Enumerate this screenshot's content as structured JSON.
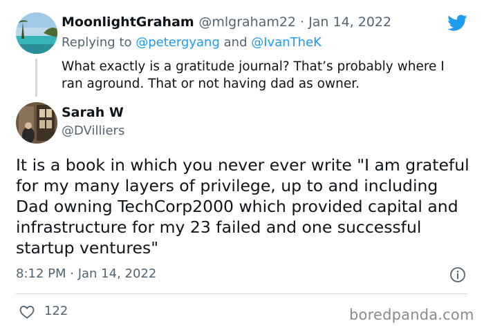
{
  "reply_tweet": {
    "display_name": "MoonlightGraham",
    "handle": "@mlgraham22",
    "date": "Jan 14, 2022",
    "replying_prefix": "Replying to",
    "replying_to_1": "@petergyang",
    "replying_and": "and",
    "replying_to_2": "@IvanTheK",
    "text": "What exactly is a gratitude journal? That’s probably where I ran aground. That or not having dad as owner."
  },
  "main_tweet": {
    "display_name": "Sarah W",
    "handle": "@DVilliers",
    "text": "It is a book in which you never ever write \"I am grateful for my many layers of privilege,  up to and including Dad owning TechCorp2000 which provided capital and infrastructure for my 23 failed and one successful startup ventures\"",
    "timestamp": "8:12 PM · Jan 14, 2022",
    "like_count": "122"
  },
  "watermark": "boredpanda.com",
  "icons": {
    "logo": "twitter-bird-icon",
    "info": "info-icon",
    "like": "heart-icon"
  },
  "colors": {
    "accent": "#1d9bf0",
    "secondary_text": "#536471",
    "primary_text": "#0f1419"
  }
}
